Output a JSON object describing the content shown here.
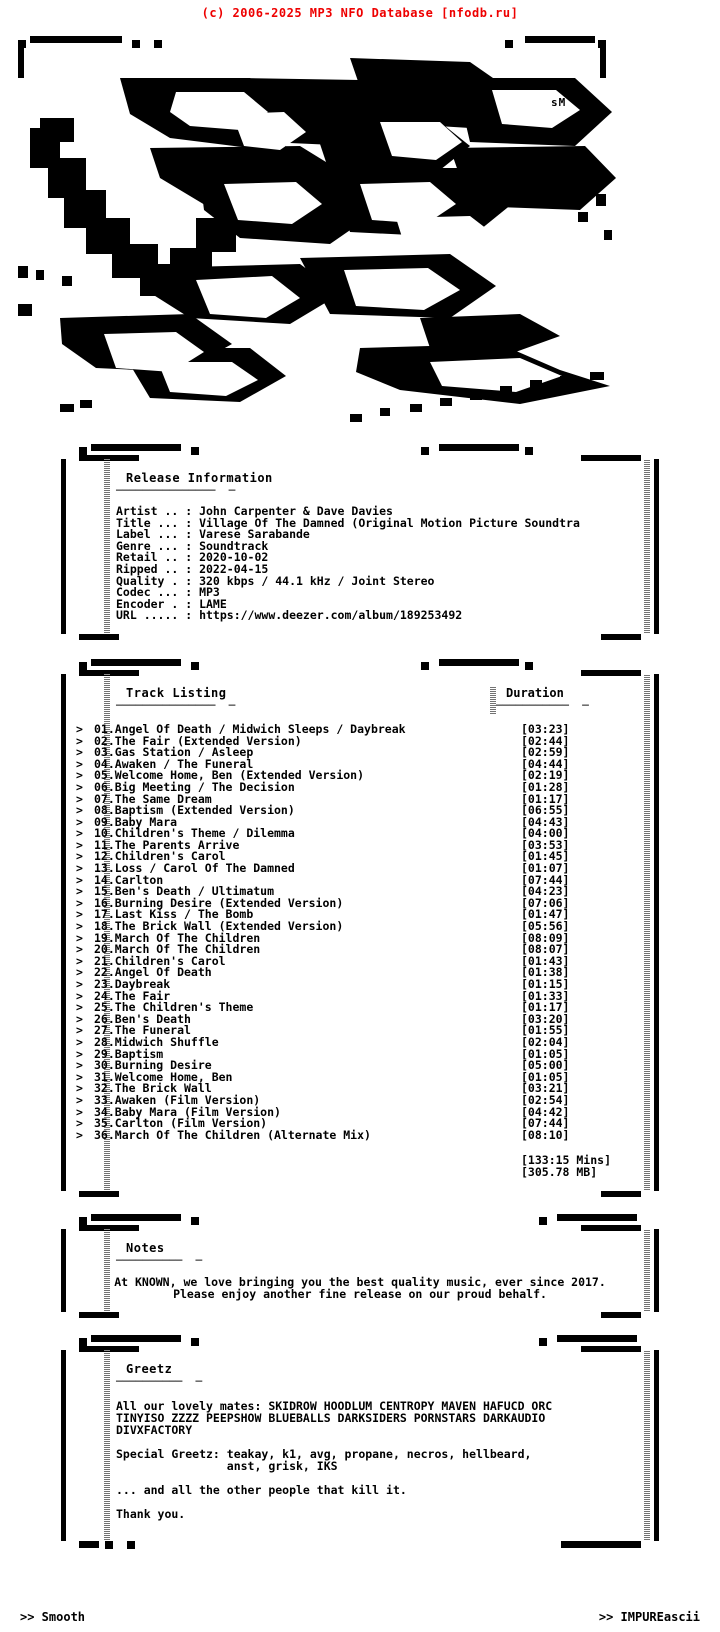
{
  "header": {
    "copyright": "(c) 2006-2025 MP3 NFO Database [nfodb.ru]",
    "copyright_color": "#ee0000"
  },
  "logo": {
    "signature": "sM",
    "ascii": "                ███████▄    ▄████▄     ▄███▄   ▄█▄  ▄█▄\n   ▄▄▄▄▄▄▄▄▄▄   ████████   ███████    ██████  ███  ███\n  ████████████  ▀██████▀  ████████   ███████  ███  ███\n  ███▀    ▀███   █████▀  ████▀▀███  ███▀ ███  ███▄▄███\n  ███      ███   ████▀  ████   ███  ███  ███  ████████\n  ███▄▄▄▄▄███▀  ▄███▀   ███▄▄▄███▀  ███▄▄███  ███▀▀███\n  █████████▀   ▄███▀    ▀███████▀    ▀████▀   ███  ███\n  ███▀▀▀▀▀     ███▀       ▀▀▀▀▀                    \n  ███         ▄██▀         ▄▄▄▄▄▄▄▄▄▄▄▄▄▄▄▄▄▄▄\n  ▀▀▀        ▀▀▀          ▀▀▀▀▀▀▀▀▀▀▀▀▀▀▀▀▀▀▀▀▀"
  },
  "release": {
    "title": "Release Information",
    "rule": "───────────────  ─",
    "fields": [
      {
        "label": "Artist .. :",
        "value": "John Carpenter & Dave Davies"
      },
      {
        "label": "Title ... :",
        "value": "Village Of The Damned (Original Motion Picture Soundtra"
      },
      {
        "label": "Label ... :",
        "value": "Varese Sarabande"
      },
      {
        "label": "Genre ... :",
        "value": "Soundtrack"
      },
      {
        "label": "Retail .. :",
        "value": "2020-10-02"
      },
      {
        "label": "Ripped .. :",
        "value": "2022-04-15"
      },
      {
        "label": "Quality . :",
        "value": "320 kbps / 44.1 kHz / Joint Stereo"
      },
      {
        "label": "Codec ... :",
        "value": "MP3"
      },
      {
        "label": "Encoder . :",
        "value": "LAME"
      },
      {
        "label": "URL ..... :",
        "value": "https://www.deezer.com/album/189253492"
      }
    ]
  },
  "tracklist": {
    "title": "Track Listing",
    "rule": "───────────────  ─",
    "duration_header": "Duration",
    "duration_rule": "───────────  ─",
    "bullet": ">",
    "tracks": [
      {
        "n": "01",
        "name": "Angel Of Death / Midwich Sleeps / Daybreak",
        "duration": "[03:23]"
      },
      {
        "n": "02",
        "name": "The Fair (Extended Version)",
        "duration": "[02:44]"
      },
      {
        "n": "03",
        "name": "Gas Station / Asleep",
        "duration": "[02:59]"
      },
      {
        "n": "04",
        "name": "Awaken / The Funeral",
        "duration": "[04:44]"
      },
      {
        "n": "05",
        "name": "Welcome Home, Ben (Extended Version)",
        "duration": "[02:19]"
      },
      {
        "n": "06",
        "name": "Big Meeting / The Decision",
        "duration": "[01:28]"
      },
      {
        "n": "07",
        "name": "The Same Dream",
        "duration": "[01:17]"
      },
      {
        "n": "08",
        "name": "Baptism (Extended Version)",
        "duration": "[06:55]"
      },
      {
        "n": "09",
        "name": "Baby Mara",
        "duration": "[04:43]"
      },
      {
        "n": "10",
        "name": "Children's Theme / Dilemma",
        "duration": "[04:00]"
      },
      {
        "n": "11",
        "name": "The Parents Arrive",
        "duration": "[03:53]"
      },
      {
        "n": "12",
        "name": "Children's Carol",
        "duration": "[01:45]"
      },
      {
        "n": "13",
        "name": "Loss / Carol Of The Damned",
        "duration": "[01:07]"
      },
      {
        "n": "14",
        "name": "Carlton",
        "duration": "[07:44]"
      },
      {
        "n": "15",
        "name": "Ben's Death / Ultimatum",
        "duration": "[04:23]"
      },
      {
        "n": "16",
        "name": "Burning Desire (Extended Version)",
        "duration": "[07:06]"
      },
      {
        "n": "17",
        "name": "Last Kiss / The Bomb",
        "duration": "[01:47]"
      },
      {
        "n": "18",
        "name": "The Brick Wall (Extended Version)",
        "duration": "[05:56]"
      },
      {
        "n": "19",
        "name": "March Of The Children",
        "duration": "[08:09]"
      },
      {
        "n": "20",
        "name": "March Of The Children",
        "duration": "[08:07]"
      },
      {
        "n": "21",
        "name": "Children's Carol",
        "duration": "[01:43]"
      },
      {
        "n": "22",
        "name": "Angel Of Death",
        "duration": "[01:38]"
      },
      {
        "n": "23",
        "name": "Daybreak",
        "duration": "[01:15]"
      },
      {
        "n": "24",
        "name": "The Fair",
        "duration": "[01:33]"
      },
      {
        "n": "25",
        "name": "The Children's Theme",
        "duration": "[01:17]"
      },
      {
        "n": "26",
        "name": "Ben's Death",
        "duration": "[03:20]"
      },
      {
        "n": "27",
        "name": "The Funeral",
        "duration": "[01:55]"
      },
      {
        "n": "28",
        "name": "Midwich Shuffle",
        "duration": "[02:04]"
      },
      {
        "n": "29",
        "name": "Baptism",
        "duration": "[01:05]"
      },
      {
        "n": "30",
        "name": "Burning Desire",
        "duration": "[05:00]"
      },
      {
        "n": "31",
        "name": "Welcome Home, Ben",
        "duration": "[01:05]"
      },
      {
        "n": "32",
        "name": "The Brick Wall",
        "duration": "[03:21]"
      },
      {
        "n": "33",
        "name": "Awaken (Film Version)",
        "duration": "[02:54]"
      },
      {
        "n": "34",
        "name": "Baby Mara (Film Version)",
        "duration": "[04:42]"
      },
      {
        "n": "35",
        "name": "Carlton (Film Version)",
        "duration": "[07:44]"
      },
      {
        "n": "36",
        "name": "March Of The Children (Alternate Mix)",
        "duration": "[08:10]"
      }
    ],
    "total_time": "[133:15 Mins]",
    "total_size": "[305.78 MB]"
  },
  "notes": {
    "title": "Notes",
    "rule": "──────────  ─",
    "lines": [
      "At KNOWN, we love bringing you the best quality music, ever since 2017.",
      "Please enjoy another fine release on our proud behalf."
    ]
  },
  "greetz": {
    "title": "Greetz",
    "rule": "──────────  ─",
    "lines": [
      "All our lovely mates: SKIDROW HOODLUM CENTROPY MAVEN HAFUCD ORC",
      "TINYISO ZZZZ PEEPSHOW BLUEBALLS DARKSIDERS PORNSTARS DARKAUDIO",
      "DIVXFACTORY",
      "",
      "Special Greetz: teakay, k1, avg, propane, necros, hellbeard,",
      "                anst, grisk, IKS",
      "",
      "... and all the other people that kill it.",
      "",
      "Thank you."
    ]
  },
  "footer": {
    "left": ">> Smooth",
    "right": ">> IMPUREascii"
  }
}
